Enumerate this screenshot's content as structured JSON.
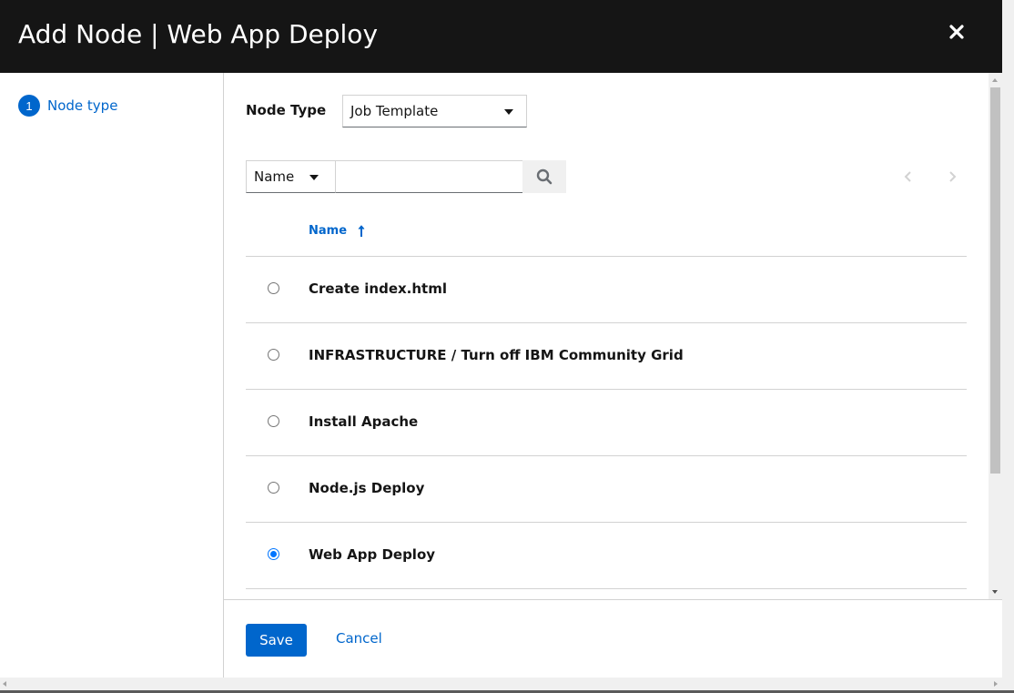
{
  "modal": {
    "title": "Add Node | Web App Deploy",
    "close_icon": "close-icon"
  },
  "wizard": {
    "steps": [
      {
        "number": "1",
        "label": "Node type"
      }
    ]
  },
  "node_type": {
    "label": "Node Type",
    "selected": "Job Template"
  },
  "filter": {
    "field": "Name",
    "search_value": "",
    "search_icon": "search-icon"
  },
  "table": {
    "column_name": "Name",
    "sort": "ascending",
    "rows": [
      {
        "name": "Create index.html",
        "selected": false
      },
      {
        "name": "INFRASTRUCTURE / Turn off IBM Community Grid",
        "selected": false
      },
      {
        "name": "Install Apache",
        "selected": false
      },
      {
        "name": "Node.js Deploy",
        "selected": false
      },
      {
        "name": "Web App Deploy",
        "selected": true
      }
    ]
  },
  "footer": {
    "save_label": "Save",
    "cancel_label": "Cancel"
  },
  "colors": {
    "header_bg": "#151515",
    "accent": "#0066cc",
    "border": "#d2d2d2"
  }
}
